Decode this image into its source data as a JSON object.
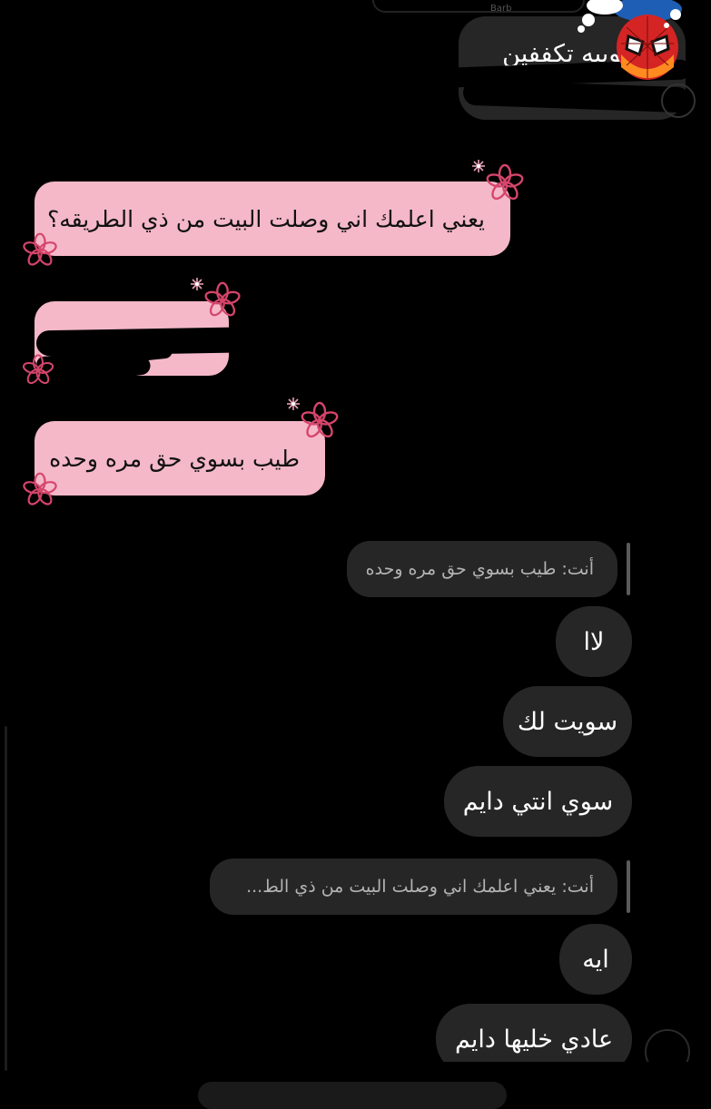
{
  "top_partial_label": "Barb",
  "received": [
    {
      "text": "يعني اعلمك اني وصلت البيت من ذي الطريقه؟"
    },
    {
      "text": ""
    },
    {
      "text": "طيب بسوي حق مره وحده"
    }
  ],
  "sent_top": {
    "text": "سوييه تكففين"
  },
  "replies": [
    {
      "quote": "أنت: طيب بسوي حق مره وحده"
    },
    {
      "quote": "أنت: يعني اعلمك اني وصلت البيت من ذي الط..."
    }
  ],
  "sent": [
    {
      "text": "لاا"
    },
    {
      "text": "سويت لك"
    },
    {
      "text": "سوي انتي دايم"
    },
    {
      "text": "ايه"
    },
    {
      "text": "عادي خليها دايم"
    }
  ],
  "colors": {
    "background": "#000000",
    "my_bubble": "#262626",
    "their_bubble": "#f4b8c9",
    "flower": "#d6456b"
  },
  "icons": {
    "sticker": "spiderman-sticker-icon",
    "flowers": "flower-icon"
  }
}
